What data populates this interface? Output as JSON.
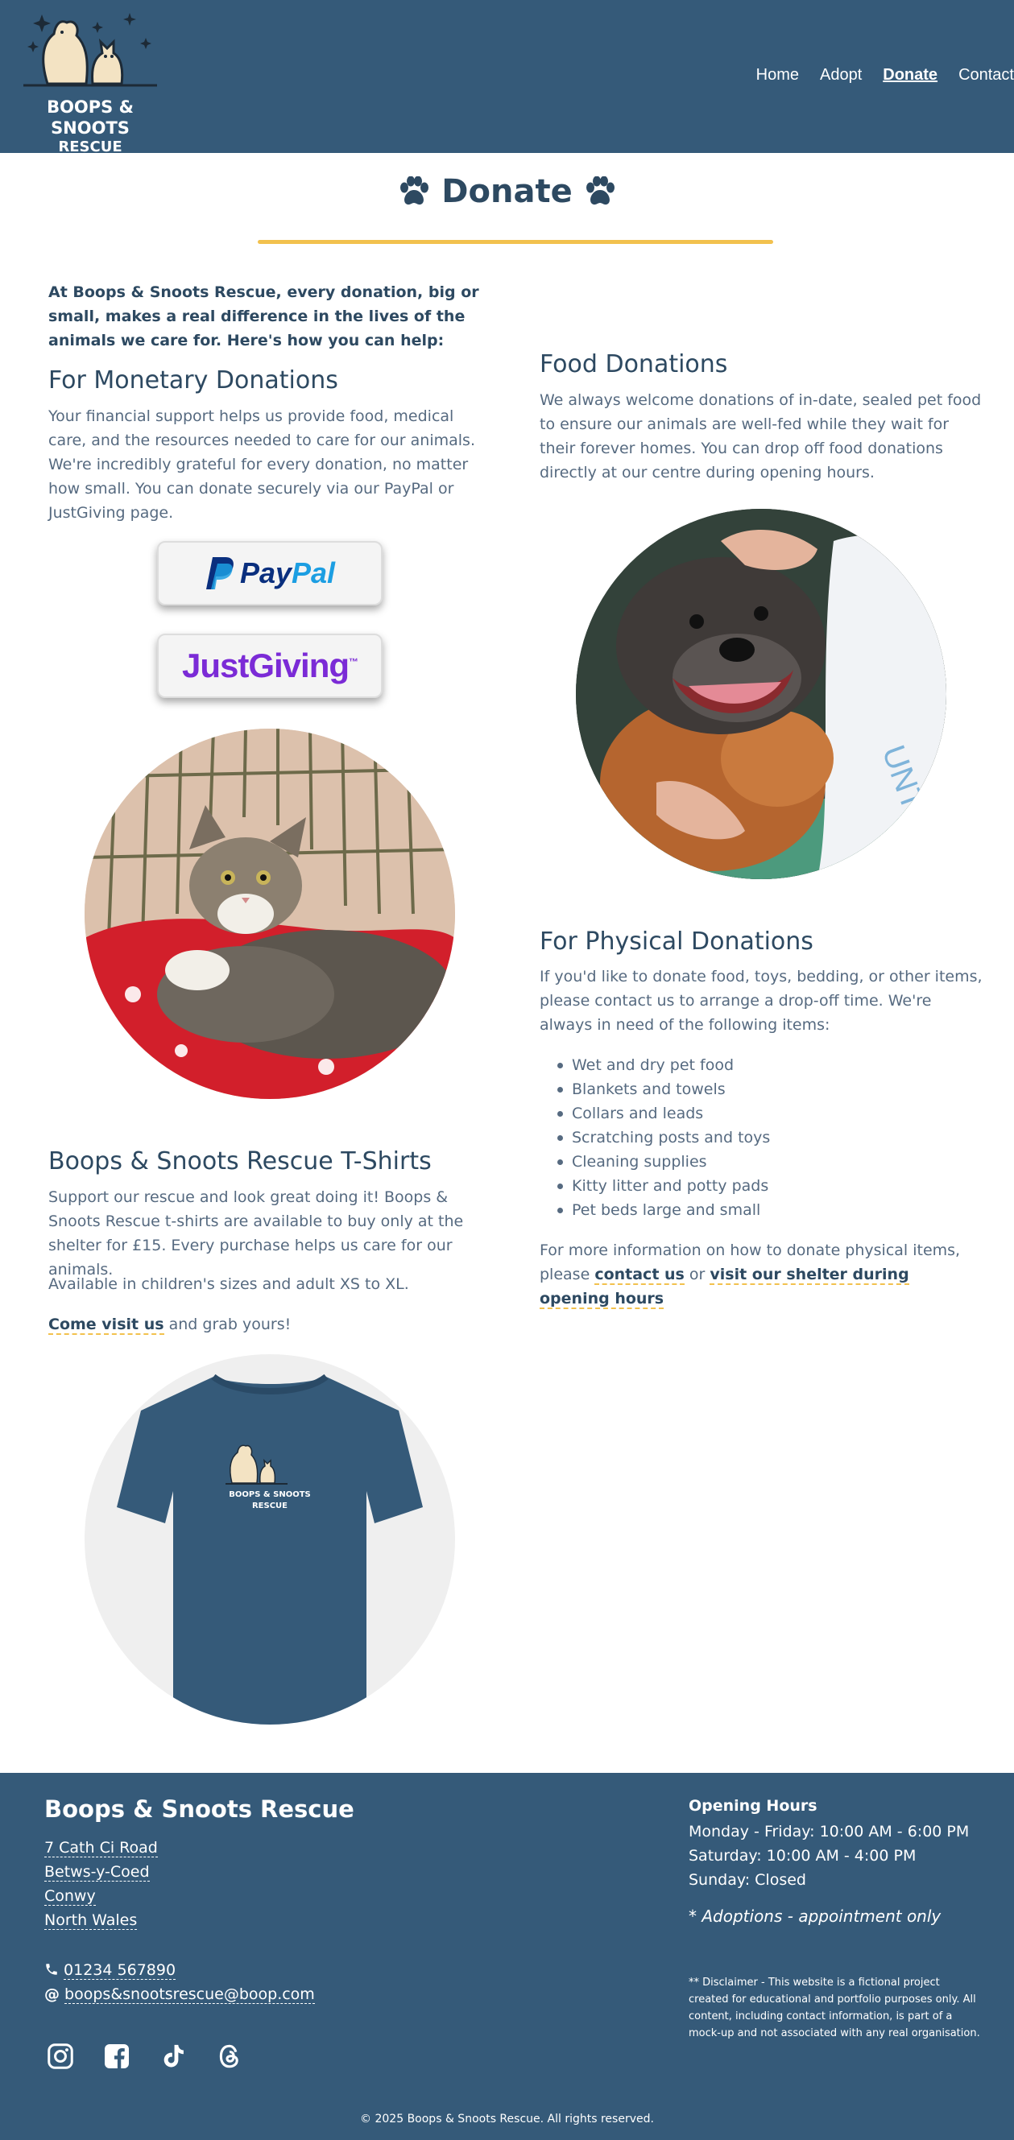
{
  "brand": {
    "name": "BOOPS & SNOOTS",
    "sub": "RESCUE"
  },
  "nav": {
    "items": [
      "Home",
      "Adopt",
      "Donate",
      "Contact"
    ],
    "active": "Donate"
  },
  "page": {
    "title": "Donate"
  },
  "intro": "At Boops & Snoots Rescue, every donation, big or small, makes a real difference in the lives of the animals we care for. Here's how you can help:",
  "monetary": {
    "heading": "For Monetary Donations",
    "text": "Your financial support helps us provide food, medical care, and the resources needed to care for our animals. We're incredibly grateful for every donation, no matter how small. You can donate securely via our PayPal or JustGiving page.",
    "paypal_a": "Pay",
    "paypal_b": "Pal",
    "justgiving": "JustGiving",
    "justgiving_tm": "™"
  },
  "food": {
    "heading": "Food Donations",
    "text": "We always welcome donations of in-date, sealed pet food to ensure our animals are well-fed while they wait for their forever homes. You can drop off food donations directly at our centre during opening hours."
  },
  "physical": {
    "heading": "For Physical Donations",
    "text": "If you'd like to donate food, toys, bedding, or other items, please contact us to arrange a drop-off time. We're always in need of the following items:",
    "items": [
      "Wet and dry pet food",
      "Blankets and towels",
      "Collars and leads",
      "Scratching posts and toys",
      "Cleaning supplies",
      "Kitty litter and potty pads",
      "Pet beds large and small"
    ],
    "more_a": "For more information on how to donate physical items, please ",
    "more_link1": "contact us",
    "more_or": " or ",
    "more_link2": "visit our shelter during opening hours"
  },
  "tshirts": {
    "heading": "Boops & Snoots Rescue T-Shirts",
    "text": "Support our rescue and look great doing it! Boops & Snoots Rescue t-shirts are available to buy only at the shelter for £15. Every purchase helps us care for our animals.",
    "sizes": "Available in children's sizes and adult XS to XL.",
    "cta_link": "Come visit us",
    "cta_rest": " and grab yours!",
    "shirt_name": "BOOPS & SNOOTS",
    "shirt_sub": "RESCUE"
  },
  "footer": {
    "brand": "Boops & Snoots Rescue",
    "address": [
      "7 Cath Ci Road",
      "Betws-y-Coed",
      "Conwy",
      "North Wales"
    ],
    "phone": "01234 567890",
    "email": "boops&snootsrescue@boop.com",
    "hours_heading": "Opening Hours",
    "hours": [
      "Monday - Friday: 10:00 AM - 6:00 PM",
      "Saturday: 10:00 AM - 4:00 PM",
      "Sunday: Closed"
    ],
    "note": "* Adoptions - appointment only",
    "disclaimer": "** Disclaimer - This website is a fictional project created for educational and portfolio purposes only. All content, including contact information, is part of a mock-up and not associated with any real organisation.",
    "copyright": "© 2025 Boops & Snoots Rescue. All rights reserved.",
    "social": [
      "instagram-icon",
      "facebook-icon",
      "tiktok-icon",
      "threads-icon"
    ]
  },
  "colors": {
    "header_bg": "#355a79",
    "accent": "#f2c14e",
    "heading": "#2d4961"
  }
}
